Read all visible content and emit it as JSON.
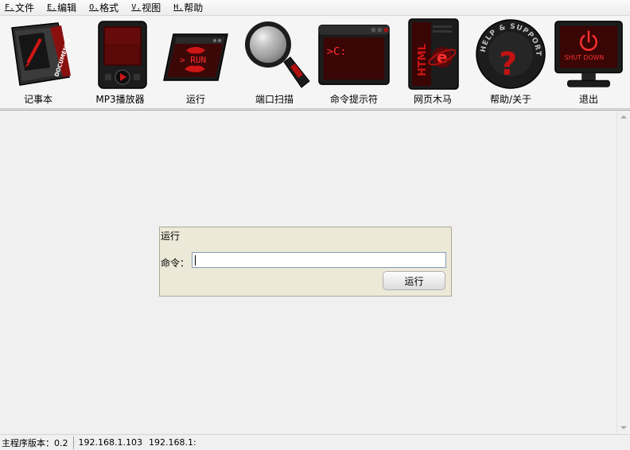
{
  "menubar": {
    "items": [
      {
        "accel": "F.",
        "label": "文件"
      },
      {
        "accel": "E.",
        "label": "编辑"
      },
      {
        "accel": "O.",
        "label": "格式"
      },
      {
        "accel": "V.",
        "label": "视图"
      },
      {
        "accel": "H.",
        "label": "帮助"
      }
    ]
  },
  "toolbar": {
    "items": [
      {
        "label": "记事本",
        "icon": "documents-icon",
        "icon_text": "DOCUMENTS"
      },
      {
        "label": "MP3播放器",
        "icon": "mp3-player-icon"
      },
      {
        "label": "运行",
        "icon": "run-icon",
        "icon_text": "> RUN"
      },
      {
        "label": "端口扫描",
        "icon": "magnifier-icon"
      },
      {
        "label": "命令提示符",
        "icon": "command-prompt-icon",
        "icon_text": ">C:"
      },
      {
        "label": "网页木马",
        "icon": "html-ie-icon",
        "icon_text": "HTML"
      },
      {
        "label": "帮助/关于",
        "icon": "help-support-icon",
        "icon_text": "HELP & SUPPORT"
      },
      {
        "label": "退出",
        "icon": "shutdown-icon",
        "icon_text": "SHUT DOWN"
      }
    ]
  },
  "run_dialog": {
    "title": "运行",
    "command_label": "命令：",
    "command_value": "",
    "run_button": "运行"
  },
  "statusbar": {
    "version": "主程序版本：0.2",
    "ip1": "192.168.1.103",
    "ip2": "192.168.1:"
  },
  "colors": {
    "icon_red": "#cc1111",
    "icon_dark": "#1a1a1a",
    "panel_bg": "#ece9d8"
  }
}
